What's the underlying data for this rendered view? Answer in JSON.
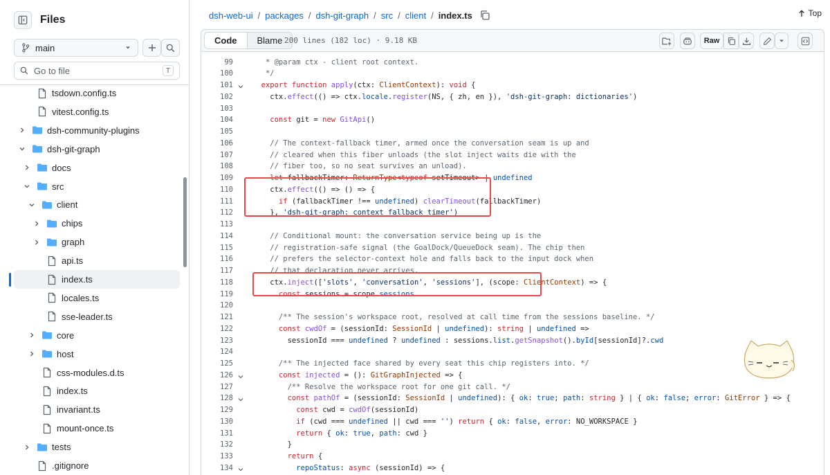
{
  "sidebar": {
    "title": "Files",
    "branch": "main",
    "search_placeholder": "Go to file",
    "search_shortcut": "T",
    "tree": [
      {
        "name": "tsdown.config.ts",
        "type": "file",
        "depth": 2
      },
      {
        "name": "vitest.config.ts",
        "type": "file",
        "depth": 2
      },
      {
        "name": "dsh-community-plugins",
        "type": "folder",
        "depth": 1,
        "expanded": false
      },
      {
        "name": "dsh-git-graph",
        "type": "folder",
        "depth": 1,
        "expanded": true
      },
      {
        "name": "docs",
        "type": "folder",
        "depth": 2,
        "expanded": false
      },
      {
        "name": "src",
        "type": "folder",
        "depth": 2,
        "expanded": true
      },
      {
        "name": "client",
        "type": "folder",
        "depth": 3,
        "expanded": true
      },
      {
        "name": "chips",
        "type": "folder",
        "depth": 4,
        "expanded": false
      },
      {
        "name": "graph",
        "type": "folder",
        "depth": 4,
        "expanded": false
      },
      {
        "name": "api.ts",
        "type": "file",
        "depth": 4
      },
      {
        "name": "index.ts",
        "type": "file",
        "depth": 4,
        "selected": true
      },
      {
        "name": "locales.ts",
        "type": "file",
        "depth": 4
      },
      {
        "name": "sse-leader.ts",
        "type": "file",
        "depth": 4
      },
      {
        "name": "core",
        "type": "folder",
        "depth": 3,
        "expanded": false
      },
      {
        "name": "host",
        "type": "folder",
        "depth": 3,
        "expanded": false
      },
      {
        "name": "css-modules.d.ts",
        "type": "file",
        "depth": 3
      },
      {
        "name": "index.ts",
        "type": "file",
        "depth": 3
      },
      {
        "name": "invariant.ts",
        "type": "file",
        "depth": 3
      },
      {
        "name": "mount-once.ts",
        "type": "file",
        "depth": 3
      },
      {
        "name": "tests",
        "type": "folder",
        "depth": 2,
        "expanded": false
      },
      {
        "name": ".gitignore",
        "type": "file",
        "depth": 2
      }
    ]
  },
  "breadcrumb": {
    "items": [
      "dsh-web-ui",
      "packages",
      "dsh-git-graph",
      "src",
      "client"
    ],
    "file": "index.ts"
  },
  "top_label": "Top",
  "file_header": {
    "tab_code": "Code",
    "tab_blame": "Blame",
    "meta": "200 lines (182 loc) · 9.18 KB",
    "raw_label": "Raw"
  },
  "code": [
    {
      "n": "99",
      "fold": false,
      "segs": [
        [
          "c",
          "   * @param ctx - client root context."
        ]
      ]
    },
    {
      "n": "100",
      "fold": false,
      "segs": [
        [
          "c",
          "   */"
        ]
      ]
    },
    {
      "n": "101",
      "fold": true,
      "segs": [
        [
          "k",
          "  export function "
        ],
        [
          "f",
          "apply"
        ],
        [
          "",
          "(ctx: "
        ],
        [
          "t",
          "ClientContext"
        ],
        [
          "",
          "): "
        ],
        [
          "k",
          "void"
        ],
        [
          "",
          " {"
        ]
      ]
    },
    {
      "n": "102",
      "fold": false,
      "segs": [
        [
          "",
          "    ctx."
        ],
        [
          "f",
          "effect"
        ],
        [
          "",
          "(() => ctx."
        ],
        [
          "p",
          "locale"
        ],
        [
          "",
          "."
        ],
        [
          "f",
          "register"
        ],
        [
          "",
          "(NS, { zh, en }), "
        ],
        [
          "s",
          "'dsh-git-graph: dictionaries'"
        ],
        [
          "",
          ")"
        ]
      ]
    },
    {
      "n": "103",
      "fold": false,
      "segs": []
    },
    {
      "n": "104",
      "fold": false,
      "segs": [
        [
          "k",
          "    const "
        ],
        [
          "",
          "git = "
        ],
        [
          "k",
          "new "
        ],
        [
          "f",
          "GitApi"
        ],
        [
          "",
          "()"
        ]
      ]
    },
    {
      "n": "105",
      "fold": false,
      "segs": []
    },
    {
      "n": "106",
      "fold": false,
      "segs": [
        [
          "c",
          "    // The context-fallback timer, armed once the conversation seam is up and"
        ]
      ]
    },
    {
      "n": "107",
      "fold": false,
      "segs": [
        [
          "c",
          "    // cleared when this fiber unloads (the slot inject waits die with the"
        ]
      ]
    },
    {
      "n": "108",
      "fold": false,
      "segs": [
        [
          "c",
          "    // fiber too, so no seat survives an unload)."
        ]
      ]
    },
    {
      "n": "109",
      "fold": false,
      "segs": [
        [
          "k",
          "    let "
        ],
        [
          "",
          "fallbackTimer: "
        ],
        [
          "t",
          "ReturnType"
        ],
        [
          "",
          "<"
        ],
        [
          "k",
          "typeof "
        ],
        [
          "",
          "setTimeout> | "
        ],
        [
          "p",
          "undefined"
        ]
      ]
    },
    {
      "n": "110",
      "fold": false,
      "segs": [
        [
          "",
          "    ctx."
        ],
        [
          "f",
          "effect"
        ],
        [
          "",
          "(() => () => {"
        ]
      ]
    },
    {
      "n": "111",
      "fold": false,
      "segs": [
        [
          "k",
          "      if "
        ],
        [
          "",
          "(fallbackTimer !== "
        ],
        [
          "p",
          "undefined"
        ],
        [
          "",
          ") "
        ],
        [
          "f",
          "clearTimeout"
        ],
        [
          "",
          "(fallbackTimer)"
        ]
      ]
    },
    {
      "n": "112",
      "fold": false,
      "segs": [
        [
          "",
          "    }, "
        ],
        [
          "s",
          "'dsh-git-graph: context fallback timer'"
        ],
        [
          "",
          ")"
        ]
      ]
    },
    {
      "n": "113",
      "fold": false,
      "segs": []
    },
    {
      "n": "114",
      "fold": false,
      "segs": [
        [
          "c",
          "    // Conditional mount: the conversation service being up is the"
        ]
      ]
    },
    {
      "n": "115",
      "fold": false,
      "segs": [
        [
          "c",
          "    // registration-safe signal (the GoalDock/QueueDock seam). The chip then"
        ]
      ]
    },
    {
      "n": "116",
      "fold": false,
      "segs": [
        [
          "c",
          "    // prefers the selector-context hole and falls back to the input dock when"
        ]
      ]
    },
    {
      "n": "117",
      "fold": false,
      "segs": [
        [
          "c",
          "    // that declaration never arrives."
        ]
      ]
    },
    {
      "n": "118",
      "fold": false,
      "segs": [
        [
          "",
          "    ctx."
        ],
        [
          "f",
          "inject"
        ],
        [
          "",
          "(["
        ],
        [
          "s",
          "'slots'"
        ],
        [
          "",
          ", "
        ],
        [
          "s",
          "'conversation'"
        ],
        [
          "",
          ", "
        ],
        [
          "s",
          "'sessions'"
        ],
        [
          "",
          "], (scope: "
        ],
        [
          "t",
          "ClientContext"
        ],
        [
          "",
          ") => {"
        ]
      ]
    },
    {
      "n": "119",
      "fold": false,
      "segs": [
        [
          "k",
          "      const "
        ],
        [
          "",
          "sessions = scope."
        ],
        [
          "p",
          "sessions"
        ]
      ]
    },
    {
      "n": "120",
      "fold": false,
      "segs": []
    },
    {
      "n": "121",
      "fold": false,
      "segs": [
        [
          "c",
          "      /** The session's workspace root, resolved at call time from the sessions baseline. */"
        ]
      ]
    },
    {
      "n": "122",
      "fold": false,
      "segs": [
        [
          "k",
          "      const "
        ],
        [
          "f",
          "cwdOf"
        ],
        [
          "",
          " = (sessionId: "
        ],
        [
          "t",
          "SessionId"
        ],
        [
          "",
          " | "
        ],
        [
          "p",
          "undefined"
        ],
        [
          "",
          "): "
        ],
        [
          "k",
          "string"
        ],
        [
          "",
          " | "
        ],
        [
          "p",
          "undefined"
        ],
        [
          "",
          " =>"
        ]
      ]
    },
    {
      "n": "123",
      "fold": false,
      "segs": [
        [
          "",
          "        sessionId === "
        ],
        [
          "p",
          "undefined"
        ],
        [
          "",
          " ? "
        ],
        [
          "p",
          "undefined"
        ],
        [
          "",
          " : sessions."
        ],
        [
          "p",
          "list"
        ],
        [
          "",
          "."
        ],
        [
          "f",
          "getSnapshot"
        ],
        [
          "",
          "()."
        ],
        [
          "p",
          "byId"
        ],
        [
          "",
          "[sessionId]?."
        ],
        [
          "p",
          "cwd"
        ]
      ]
    },
    {
      "n": "124",
      "fold": false,
      "segs": []
    },
    {
      "n": "125",
      "fold": false,
      "segs": [
        [
          "c",
          "      /** The injected face shared by every seat this chip registers into. */"
        ]
      ]
    },
    {
      "n": "126",
      "fold": true,
      "segs": [
        [
          "k",
          "      const "
        ],
        [
          "f",
          "injected"
        ],
        [
          "",
          " = (): "
        ],
        [
          "t",
          "GitGraphInjected"
        ],
        [
          "",
          " => {"
        ]
      ]
    },
    {
      "n": "127",
      "fold": false,
      "segs": [
        [
          "c",
          "        /** Resolve the workspace root for one git call. */"
        ]
      ]
    },
    {
      "n": "128",
      "fold": true,
      "segs": [
        [
          "k",
          "        const "
        ],
        [
          "f",
          "pathOf"
        ],
        [
          "",
          " = (sessionId: "
        ],
        [
          "t",
          "SessionId"
        ],
        [
          "",
          " | "
        ],
        [
          "p",
          "undefined"
        ],
        [
          "",
          "): { "
        ],
        [
          "p",
          "ok"
        ],
        [
          "",
          ": "
        ],
        [
          "p",
          "true"
        ],
        [
          "",
          "; "
        ],
        [
          "p",
          "path"
        ],
        [
          "",
          ": "
        ],
        [
          "k",
          "string"
        ],
        [
          "",
          " } | { "
        ],
        [
          "p",
          "ok"
        ],
        [
          "",
          ": "
        ],
        [
          "p",
          "false"
        ],
        [
          "",
          "; "
        ],
        [
          "p",
          "error"
        ],
        [
          "",
          ": "
        ],
        [
          "t",
          "GitError"
        ],
        [
          "",
          " } => {"
        ]
      ]
    },
    {
      "n": "129",
      "fold": false,
      "segs": [
        [
          "k",
          "          const "
        ],
        [
          "",
          "cwd = "
        ],
        [
          "f",
          "cwdOf"
        ],
        [
          "",
          "(sessionId)"
        ]
      ]
    },
    {
      "n": "130",
      "fold": false,
      "segs": [
        [
          "k",
          "          if "
        ],
        [
          "",
          "(cwd === "
        ],
        [
          "p",
          "undefined"
        ],
        [
          "",
          " || cwd === "
        ],
        [
          "s",
          "''"
        ],
        [
          "",
          ") "
        ],
        [
          "k",
          "return "
        ],
        [
          "",
          "{ "
        ],
        [
          "p",
          "ok"
        ],
        [
          "",
          ": "
        ],
        [
          "p",
          "false"
        ],
        [
          "",
          ", "
        ],
        [
          "p",
          "error"
        ],
        [
          "",
          ": NO_WORKSPACE }"
        ]
      ]
    },
    {
      "n": "131",
      "fold": false,
      "segs": [
        [
          "k",
          "          return "
        ],
        [
          "",
          "{ "
        ],
        [
          "p",
          "ok"
        ],
        [
          "",
          ": "
        ],
        [
          "p",
          "true"
        ],
        [
          "",
          ", "
        ],
        [
          "p",
          "path"
        ],
        [
          "",
          ": cwd }"
        ]
      ]
    },
    {
      "n": "132",
      "fold": false,
      "segs": [
        [
          "",
          "        }"
        ]
      ]
    },
    {
      "n": "133",
      "fold": false,
      "segs": [
        [
          "k",
          "        return "
        ],
        [
          "",
          "{"
        ]
      ]
    },
    {
      "n": "134",
      "fold": true,
      "segs": [
        [
          "",
          "          "
        ],
        [
          "p",
          "repoStatus"
        ],
        [
          "",
          ": "
        ],
        [
          "k",
          "async "
        ],
        [
          "",
          "(sessionId) => {"
        ]
      ]
    }
  ]
}
